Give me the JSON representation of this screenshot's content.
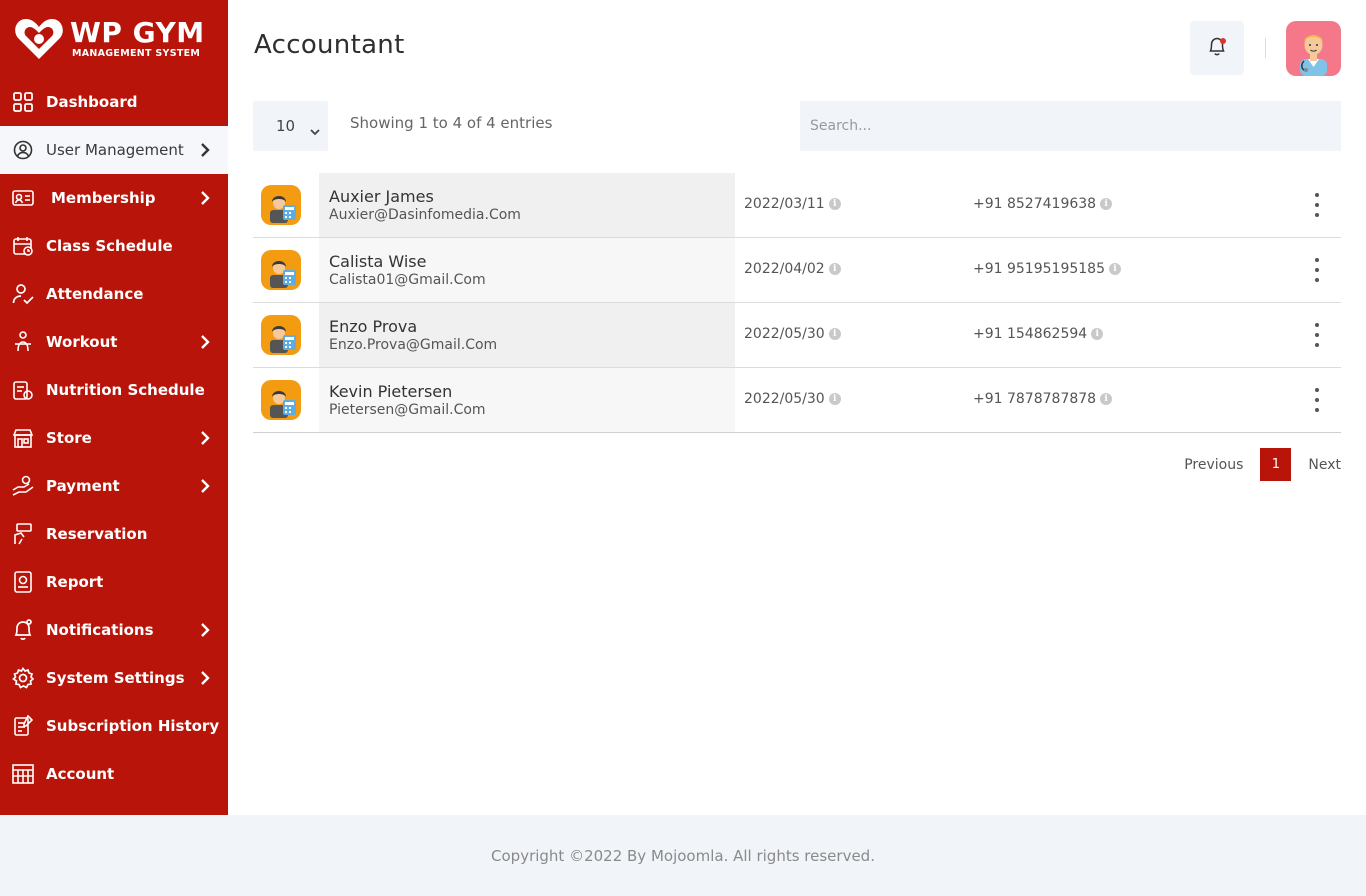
{
  "brand": {
    "title": "WP GYM",
    "subtitle": "MANAGEMENT SYSTEM"
  },
  "sidebar": {
    "items": [
      {
        "label": "Dashboard",
        "icon": "grid-icon",
        "has_children": false
      },
      {
        "label": "User Management",
        "icon": "users-gear-icon",
        "has_children": true,
        "active": true
      },
      {
        "label": "Membership",
        "icon": "id-card-icon",
        "has_children": true
      },
      {
        "label": "Class Schedule",
        "icon": "calendar-icon",
        "has_children": false
      },
      {
        "label": "Attendance",
        "icon": "user-check-icon",
        "has_children": false
      },
      {
        "label": "Workout",
        "icon": "workout-icon",
        "has_children": true
      },
      {
        "label": "Nutrition Schedule",
        "icon": "nutrition-icon",
        "has_children": false
      },
      {
        "label": "Store",
        "icon": "store-icon",
        "has_children": true
      },
      {
        "label": "Payment",
        "icon": "payment-icon",
        "has_children": true
      },
      {
        "label": "Reservation",
        "icon": "reservation-icon",
        "has_children": false
      },
      {
        "label": "Report",
        "icon": "report-icon",
        "has_children": false
      },
      {
        "label": "Notifications",
        "icon": "bell-icon",
        "has_children": true
      },
      {
        "label": "System Settings",
        "icon": "gear-icon",
        "has_children": true
      },
      {
        "label": "Subscription History",
        "icon": "history-icon",
        "has_children": false
      },
      {
        "label": "Account",
        "icon": "account-icon",
        "has_children": false
      }
    ]
  },
  "header": {
    "title": "Accountant"
  },
  "controls": {
    "page_length": "10",
    "info": "Showing 1 to 4 of 4 entries",
    "search_placeholder": "Search..."
  },
  "rows": [
    {
      "name": "Auxier James",
      "email": "Auxier@Dasinfomedia.Com",
      "date": "2022/03/11",
      "phone": "+91 8527419638"
    },
    {
      "name": "Calista Wise",
      "email": "Calista01@Gmail.Com",
      "date": "2022/04/02",
      "phone": "+91 95195195185"
    },
    {
      "name": "Enzo Prova",
      "email": "Enzo.Prova@Gmail.Com",
      "date": "2022/05/30",
      "phone": "+91 154862594"
    },
    {
      "name": "Kevin Pietersen",
      "email": "Pietersen@Gmail.Com",
      "date": "2022/05/30",
      "phone": "+91 7878787878"
    }
  ],
  "pagination": {
    "previous": "Previous",
    "current": "1",
    "next": "Next"
  },
  "footer": {
    "text": "Copyright ©2022 By Mojoomla. All rights reserved."
  },
  "colors": {
    "brand": "#b8140a",
    "panel": "#f1f4f9",
    "avatar_bg": "#f39c12",
    "profile_bg": "#f4778a"
  }
}
